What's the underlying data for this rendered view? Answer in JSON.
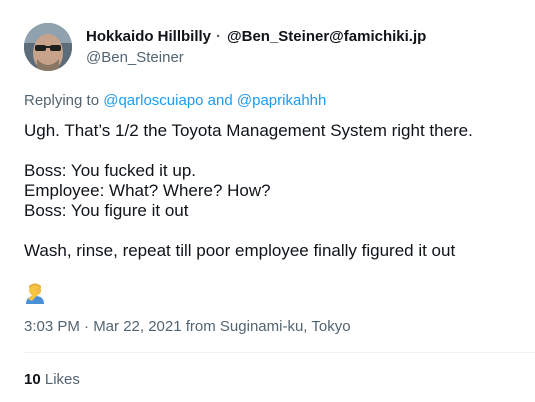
{
  "author": {
    "display_name": "Hokkaido Hillbilly",
    "separator": "·",
    "mastodon_handle": "@Ben_Steiner@famichiki.jp",
    "handle": "@Ben_Steiner"
  },
  "reply": {
    "prefix": "Replying to ",
    "user1": "@qarloscuiapo",
    "conjunction": " and ",
    "user2": "@paprikahhh"
  },
  "body": {
    "line1": "Ugh. That’s 1/2 the Toyota Management System right there.",
    "line2": "Boss: You fucked it up.",
    "line3": "Employee: What? Where? How?",
    "line4": "Boss: You figure it out",
    "line5": "Wash, rinse, repeat till poor employee finally figured it out",
    "emoji_icon": "person-facepalming-icon"
  },
  "meta": {
    "timestamp": "3:03 PM · Mar 22, 2021 from Suginami-ku, Tokyo"
  },
  "stats": {
    "likes_count": "10",
    "likes_label": " Likes"
  },
  "colors": {
    "text": "#0f1419",
    "secondary": "#536471",
    "link": "#1d9bf0"
  }
}
